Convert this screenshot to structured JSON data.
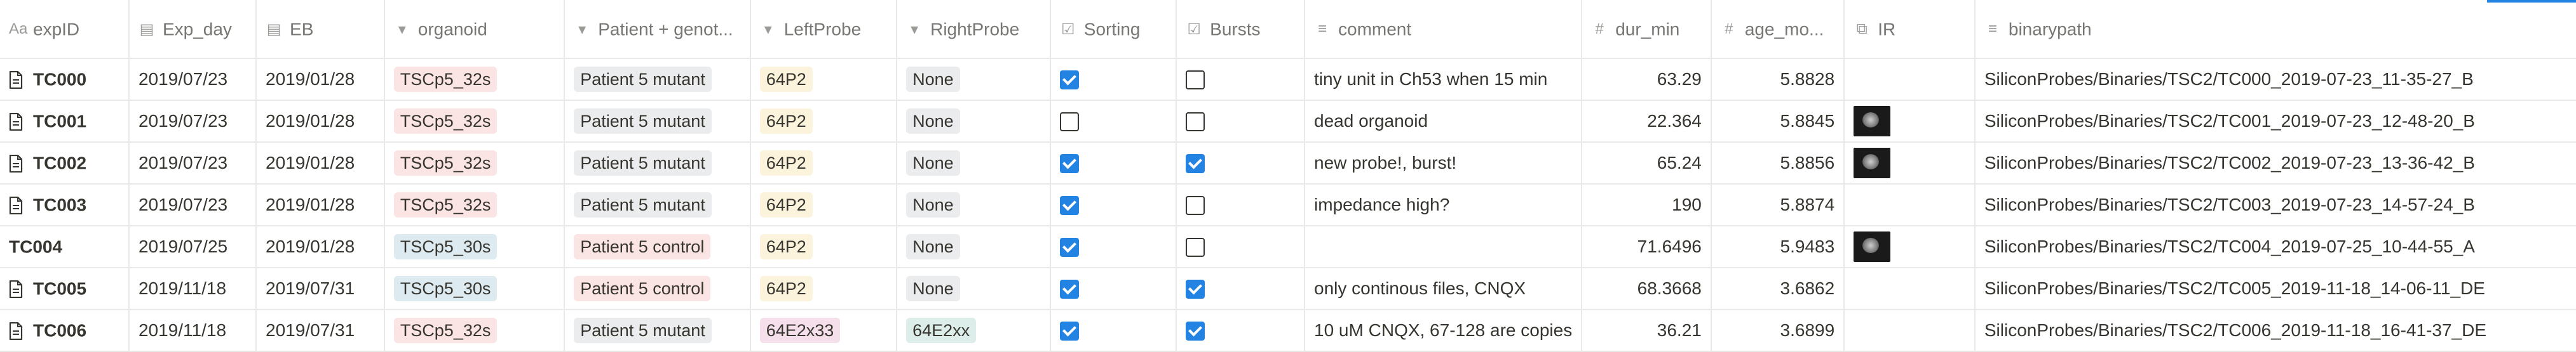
{
  "columns": [
    {
      "key": "expID",
      "label": "expID",
      "icon": "Aa"
    },
    {
      "key": "exp_day",
      "label": "Exp_day",
      "icon": "▤"
    },
    {
      "key": "eb",
      "label": "EB",
      "icon": "▤"
    },
    {
      "key": "organoid",
      "label": "organoid",
      "icon": "▾"
    },
    {
      "key": "patient",
      "label": "Patient + genot...",
      "icon": "▾"
    },
    {
      "key": "leftprobe",
      "label": "LeftProbe",
      "icon": "▾"
    },
    {
      "key": "rightprobe",
      "label": "RightProbe",
      "icon": "▾"
    },
    {
      "key": "sorting",
      "label": "Sorting",
      "icon": "☑"
    },
    {
      "key": "bursts",
      "label": "Bursts",
      "icon": "☑"
    },
    {
      "key": "comment",
      "label": "comment",
      "icon": "≡"
    },
    {
      "key": "dur_min",
      "label": "dur_min",
      "icon": "#"
    },
    {
      "key": "age_mo",
      "label": "age_mo...",
      "icon": "#"
    },
    {
      "key": "ir",
      "label": "IR",
      "icon": "⧉"
    },
    {
      "key": "binarypath",
      "label": "binarypath",
      "icon": "≡"
    }
  ],
  "colors": {
    "tag_red": "#fbe4e4",
    "tag_blue": "#ddebf1",
    "tag_gray": "#ebeced",
    "tag_yellow": "#fbf3db",
    "tag_pink": "#f4dfeb",
    "tag_green": "#ddedea",
    "checkbox_on": "#2383e2"
  },
  "rows": [
    {
      "expID": "TC000",
      "has_icon": true,
      "exp_day": "2019/07/23",
      "eb": "2019/01/28",
      "organoid": "TSCp5_32s",
      "organoid_color": "red",
      "patient": "Patient 5 mutant",
      "patient_color": "gray",
      "leftprobe": "64P2",
      "leftprobe_color": "yellow",
      "rightprobe": "None",
      "rightprobe_color": "gray",
      "sorting": true,
      "bursts": false,
      "comment": "tiny unit in Ch53 when 15 min",
      "dur_min": "63.29",
      "age_mo": "5.8828",
      "ir": false,
      "binarypath": "SiliconProbes/Binaries/TSC2/TC000_2019-07-23_11-35-27_B"
    },
    {
      "expID": "TC001",
      "has_icon": true,
      "exp_day": "2019/07/23",
      "eb": "2019/01/28",
      "organoid": "TSCp5_32s",
      "organoid_color": "red",
      "patient": "Patient 5 mutant",
      "patient_color": "gray",
      "leftprobe": "64P2",
      "leftprobe_color": "yellow",
      "rightprobe": "None",
      "rightprobe_color": "gray",
      "sorting": false,
      "bursts": false,
      "comment": "dead organoid",
      "dur_min": "22.364",
      "age_mo": "5.8845",
      "ir": true,
      "binarypath": "SiliconProbes/Binaries/TSC2/TC001_2019-07-23_12-48-20_B"
    },
    {
      "expID": "TC002",
      "has_icon": true,
      "exp_day": "2019/07/23",
      "eb": "2019/01/28",
      "organoid": "TSCp5_32s",
      "organoid_color": "red",
      "patient": "Patient 5 mutant",
      "patient_color": "gray",
      "leftprobe": "64P2",
      "leftprobe_color": "yellow",
      "rightprobe": "None",
      "rightprobe_color": "gray",
      "sorting": true,
      "bursts": true,
      "comment": "new probe!, burst!",
      "dur_min": "65.24",
      "age_mo": "5.8856",
      "ir": true,
      "binarypath": "SiliconProbes/Binaries/TSC2/TC002_2019-07-23_13-36-42_B"
    },
    {
      "expID": "TC003",
      "has_icon": true,
      "exp_day": "2019/07/23",
      "eb": "2019/01/28",
      "organoid": "TSCp5_32s",
      "organoid_color": "red",
      "patient": "Patient 5 mutant",
      "patient_color": "gray",
      "leftprobe": "64P2",
      "leftprobe_color": "yellow",
      "rightprobe": "None",
      "rightprobe_color": "gray",
      "sorting": true,
      "bursts": false,
      "comment": "impedance high?",
      "dur_min": "190",
      "age_mo": "5.8874",
      "ir": false,
      "binarypath": "SiliconProbes/Binaries/TSC2/TC003_2019-07-23_14-57-24_B"
    },
    {
      "expID": "TC004",
      "has_icon": false,
      "exp_day": "2019/07/25",
      "eb": "2019/01/28",
      "organoid": "TSCp5_30s",
      "organoid_color": "blue",
      "patient": "Patient 5 control",
      "patient_color": "red",
      "leftprobe": "64P2",
      "leftprobe_color": "yellow",
      "rightprobe": "None",
      "rightprobe_color": "gray",
      "sorting": true,
      "bursts": false,
      "comment": "",
      "dur_min": "71.6496",
      "age_mo": "5.9483",
      "ir": true,
      "binarypath": "SiliconProbes/Binaries/TSC2/TC004_2019-07-25_10-44-55_A"
    },
    {
      "expID": "TC005",
      "has_icon": true,
      "exp_day": "2019/11/18",
      "eb": "2019/07/31",
      "organoid": "TSCp5_30s",
      "organoid_color": "blue",
      "patient": "Patient 5 control",
      "patient_color": "red",
      "leftprobe": "64P2",
      "leftprobe_color": "yellow",
      "rightprobe": "None",
      "rightprobe_color": "gray",
      "sorting": true,
      "bursts": true,
      "comment": "only continous files, CNQX",
      "dur_min": "68.3668",
      "age_mo": "3.6862",
      "ir": false,
      "binarypath": "SiliconProbes/Binaries/TSC2/TC005_2019-11-18_14-06-11_DE"
    },
    {
      "expID": "TC006",
      "has_icon": true,
      "exp_day": "2019/11/18",
      "eb": "2019/07/31",
      "organoid": "TSCp5_32s",
      "organoid_color": "red",
      "patient": "Patient 5 mutant",
      "patient_color": "gray",
      "leftprobe": "64E2x33",
      "leftprobe_color": "pink",
      "rightprobe": "64E2xx",
      "rightprobe_color": "green",
      "sorting": true,
      "bursts": true,
      "comment": "10 uM CNQX, 67-128 are copies",
      "dur_min": "36.21",
      "age_mo": "3.6899",
      "ir": false,
      "binarypath": "SiliconProbes/Binaries/TSC2/TC006_2019-11-18_16-41-37_DE"
    }
  ]
}
